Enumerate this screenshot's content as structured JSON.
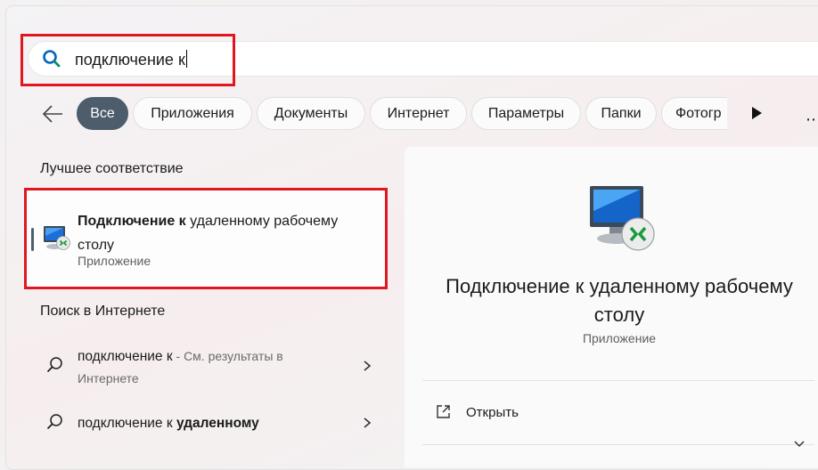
{
  "search": {
    "query": "подключение к"
  },
  "filters": {
    "items": [
      {
        "label": "Все"
      },
      {
        "label": "Приложения"
      },
      {
        "label": "Документы"
      },
      {
        "label": "Интернет"
      },
      {
        "label": "Параметры"
      },
      {
        "label": "Папки"
      },
      {
        "label": "Фотогр"
      }
    ],
    "more_icon": "⋯"
  },
  "best_match": {
    "section_title": "Лучшее соответствие",
    "title_bold": "Подключение к",
    "title_rest": " удаленному рабочему столу",
    "subtitle": "Приложение"
  },
  "web": {
    "section_title": "Поиск в Интернете",
    "items": [
      {
        "query": "подключение к",
        "suffix": " - См. результаты в Интернете"
      },
      {
        "query_plain": "подключение к ",
        "query_bold": "удаленному"
      }
    ]
  },
  "detail": {
    "title": "Подключение к удаленному рабочему столу",
    "subtitle": "Приложение",
    "actions": [
      {
        "label": "Открыть",
        "icon": "open-external-icon"
      }
    ]
  },
  "colors": {
    "active_chip": "#4d5d6b",
    "highlight": "#e0171f",
    "search_icon": "#0067c0"
  }
}
